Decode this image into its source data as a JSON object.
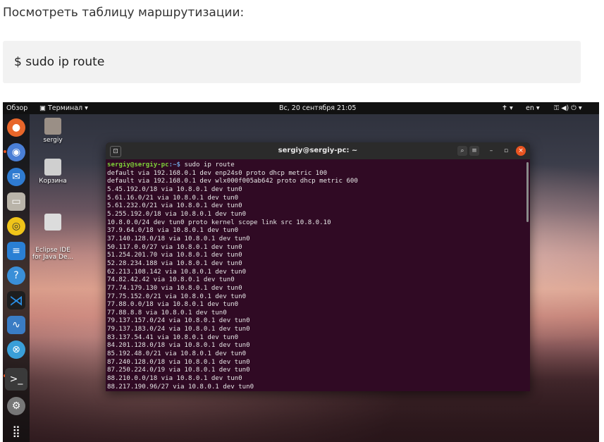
{
  "article": {
    "intro_text": "Посмотреть таблицу маршрутизации:",
    "code": "$  sudo ip route"
  },
  "topbar": {
    "activities": "Обзор",
    "app_menu": "Терминал ▾",
    "clock": "Вс, 20 сентября  21:05",
    "accessibility": "✝ ▾",
    "keyboard": "en ▾",
    "status": "⚿ ◀) ⏻ ▾"
  },
  "desktop": {
    "icons": [
      {
        "label": "sergiy"
      },
      {
        "label": "Корзина"
      },
      {
        "label": "Eclipse IDE\nfor Java De..."
      }
    ]
  },
  "terminal": {
    "title": "sergiy@sergiy-pc: ~",
    "prompt_user": "sergiy@sergiy-pc",
    "prompt_path": ":~$",
    "command": " sudo ip route",
    "lines": [
      "default via 192.168.0.1 dev enp24s0 proto dhcp metric 100",
      "default via 192.168.0.1 dev wlx000f005ab642 proto dhcp metric 600",
      "5.45.192.0/18 via 10.8.0.1 dev tun0",
      "5.61.16.0/21 via 10.8.0.1 dev tun0",
      "5.61.232.0/21 via 10.8.0.1 dev tun0",
      "5.255.192.0/18 via 10.8.0.1 dev tun0",
      "10.8.0.0/24 dev tun0 proto kernel scope link src 10.8.0.10",
      "37.9.64.0/18 via 10.8.0.1 dev tun0",
      "37.140.128.0/18 via 10.8.0.1 dev tun0",
      "50.117.0.0/27 via 10.8.0.1 dev tun0",
      "51.254.201.70 via 10.8.0.1 dev tun0",
      "52.28.234.188 via 10.8.0.1 dev tun0",
      "62.213.108.142 via 10.8.0.1 dev tun0",
      "74.82.42.42 via 10.8.0.1 dev tun0",
      "77.74.179.130 via 10.8.0.1 dev tun0",
      "77.75.152.0/21 via 10.8.0.1 dev tun0",
      "77.88.0.0/18 via 10.8.0.1 dev tun0",
      "77.88.8.8 via 10.8.0.1 dev tun0",
      "79.137.157.0/24 via 10.8.0.1 dev tun0",
      "79.137.183.0/24 via 10.8.0.1 dev tun0",
      "83.137.54.41 via 10.8.0.1 dev tun0",
      "84.201.128.0/18 via 10.8.0.1 dev tun0",
      "85.192.48.0/21 via 10.8.0.1 dev tun0",
      "87.240.128.0/18 via 10.8.0.1 dev tun0",
      "87.250.224.0/19 via 10.8.0.1 dev tun0",
      "88.210.0.0/18 via 10.8.0.1 dev tun0",
      "88.217.190.96/27 via 10.8.0.1 dev tun0"
    ]
  },
  "dock": {
    "items": [
      {
        "icon": "firefox-icon",
        "color": "#e8662a"
      },
      {
        "icon": "chromium-icon",
        "color": "#4a7fd6"
      },
      {
        "icon": "thunderbird-icon",
        "color": "#2f7bd1"
      },
      {
        "icon": "files-icon",
        "color": "#b9b4a9"
      },
      {
        "icon": "rhythmbox-icon",
        "color": "#f0c419"
      },
      {
        "icon": "writer-icon",
        "color": "#2a7fd4"
      },
      {
        "icon": "help-icon",
        "color": "#3a8fd8"
      },
      {
        "icon": "vscode-icon",
        "color": "#2a8fe6"
      },
      {
        "icon": "system-monitor-icon",
        "color": "#3a7cc4"
      },
      {
        "icon": "app-icon",
        "color": "#3a9fd8"
      },
      {
        "icon": "terminal-icon",
        "color": "#333333"
      },
      {
        "icon": "settings-icon",
        "color": "#777777"
      },
      {
        "icon": "show-apps-icon",
        "color": "#ffffff"
      }
    ]
  }
}
